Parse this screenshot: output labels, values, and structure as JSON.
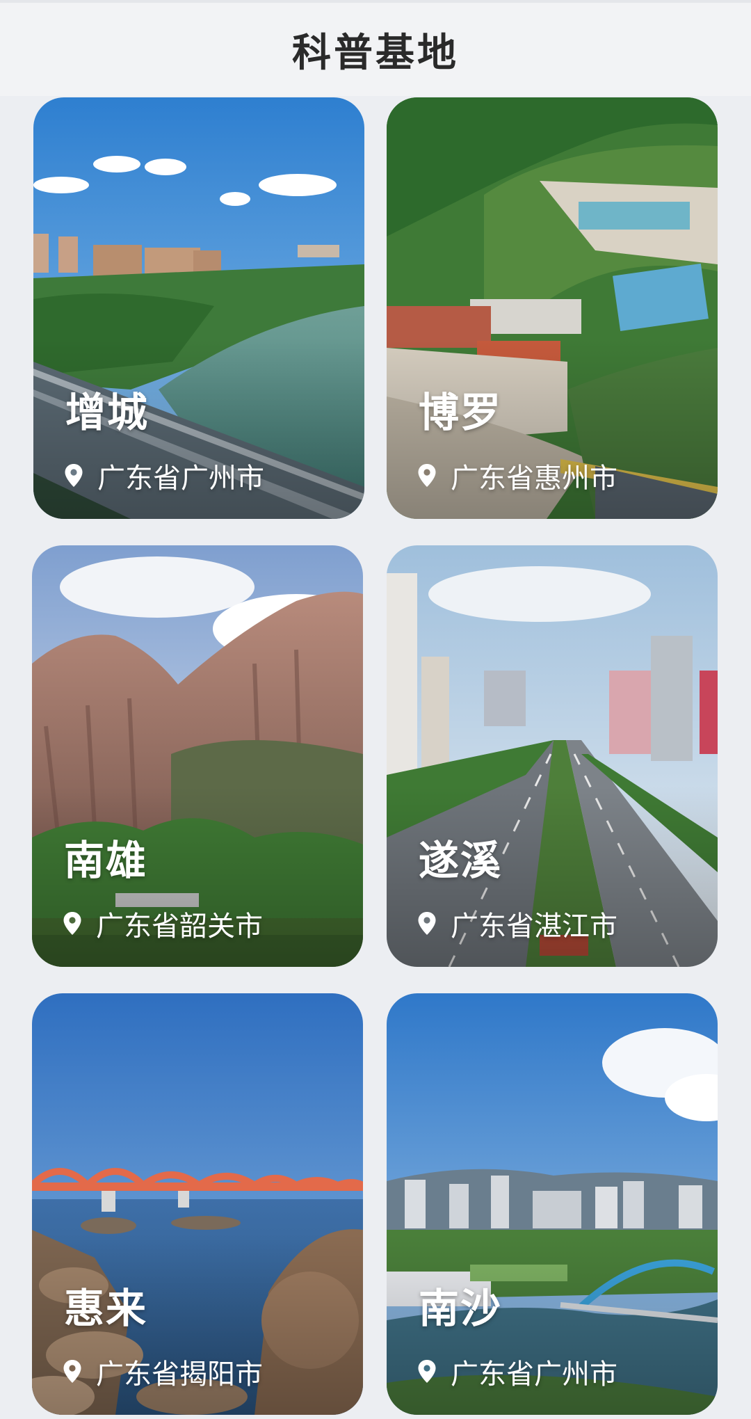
{
  "header": {
    "title": "科普基地"
  },
  "cards": [
    {
      "name": "增城",
      "location": "广东省广州市",
      "location_icon": "location-pin-icon"
    },
    {
      "name": "博罗",
      "location": "广东省惠州市",
      "location_icon": "location-pin-icon"
    },
    {
      "name": "南雄",
      "location": "广东省韶关市",
      "location_icon": "location-pin-icon"
    },
    {
      "name": "遂溪",
      "location": "广东省湛江市",
      "location_icon": "location-pin-icon"
    },
    {
      "name": "惠来",
      "location": "广东省揭阳市",
      "location_icon": "location-pin-icon"
    },
    {
      "name": "南沙",
      "location": "广东省广州市",
      "location_icon": "location-pin-icon"
    }
  ]
}
